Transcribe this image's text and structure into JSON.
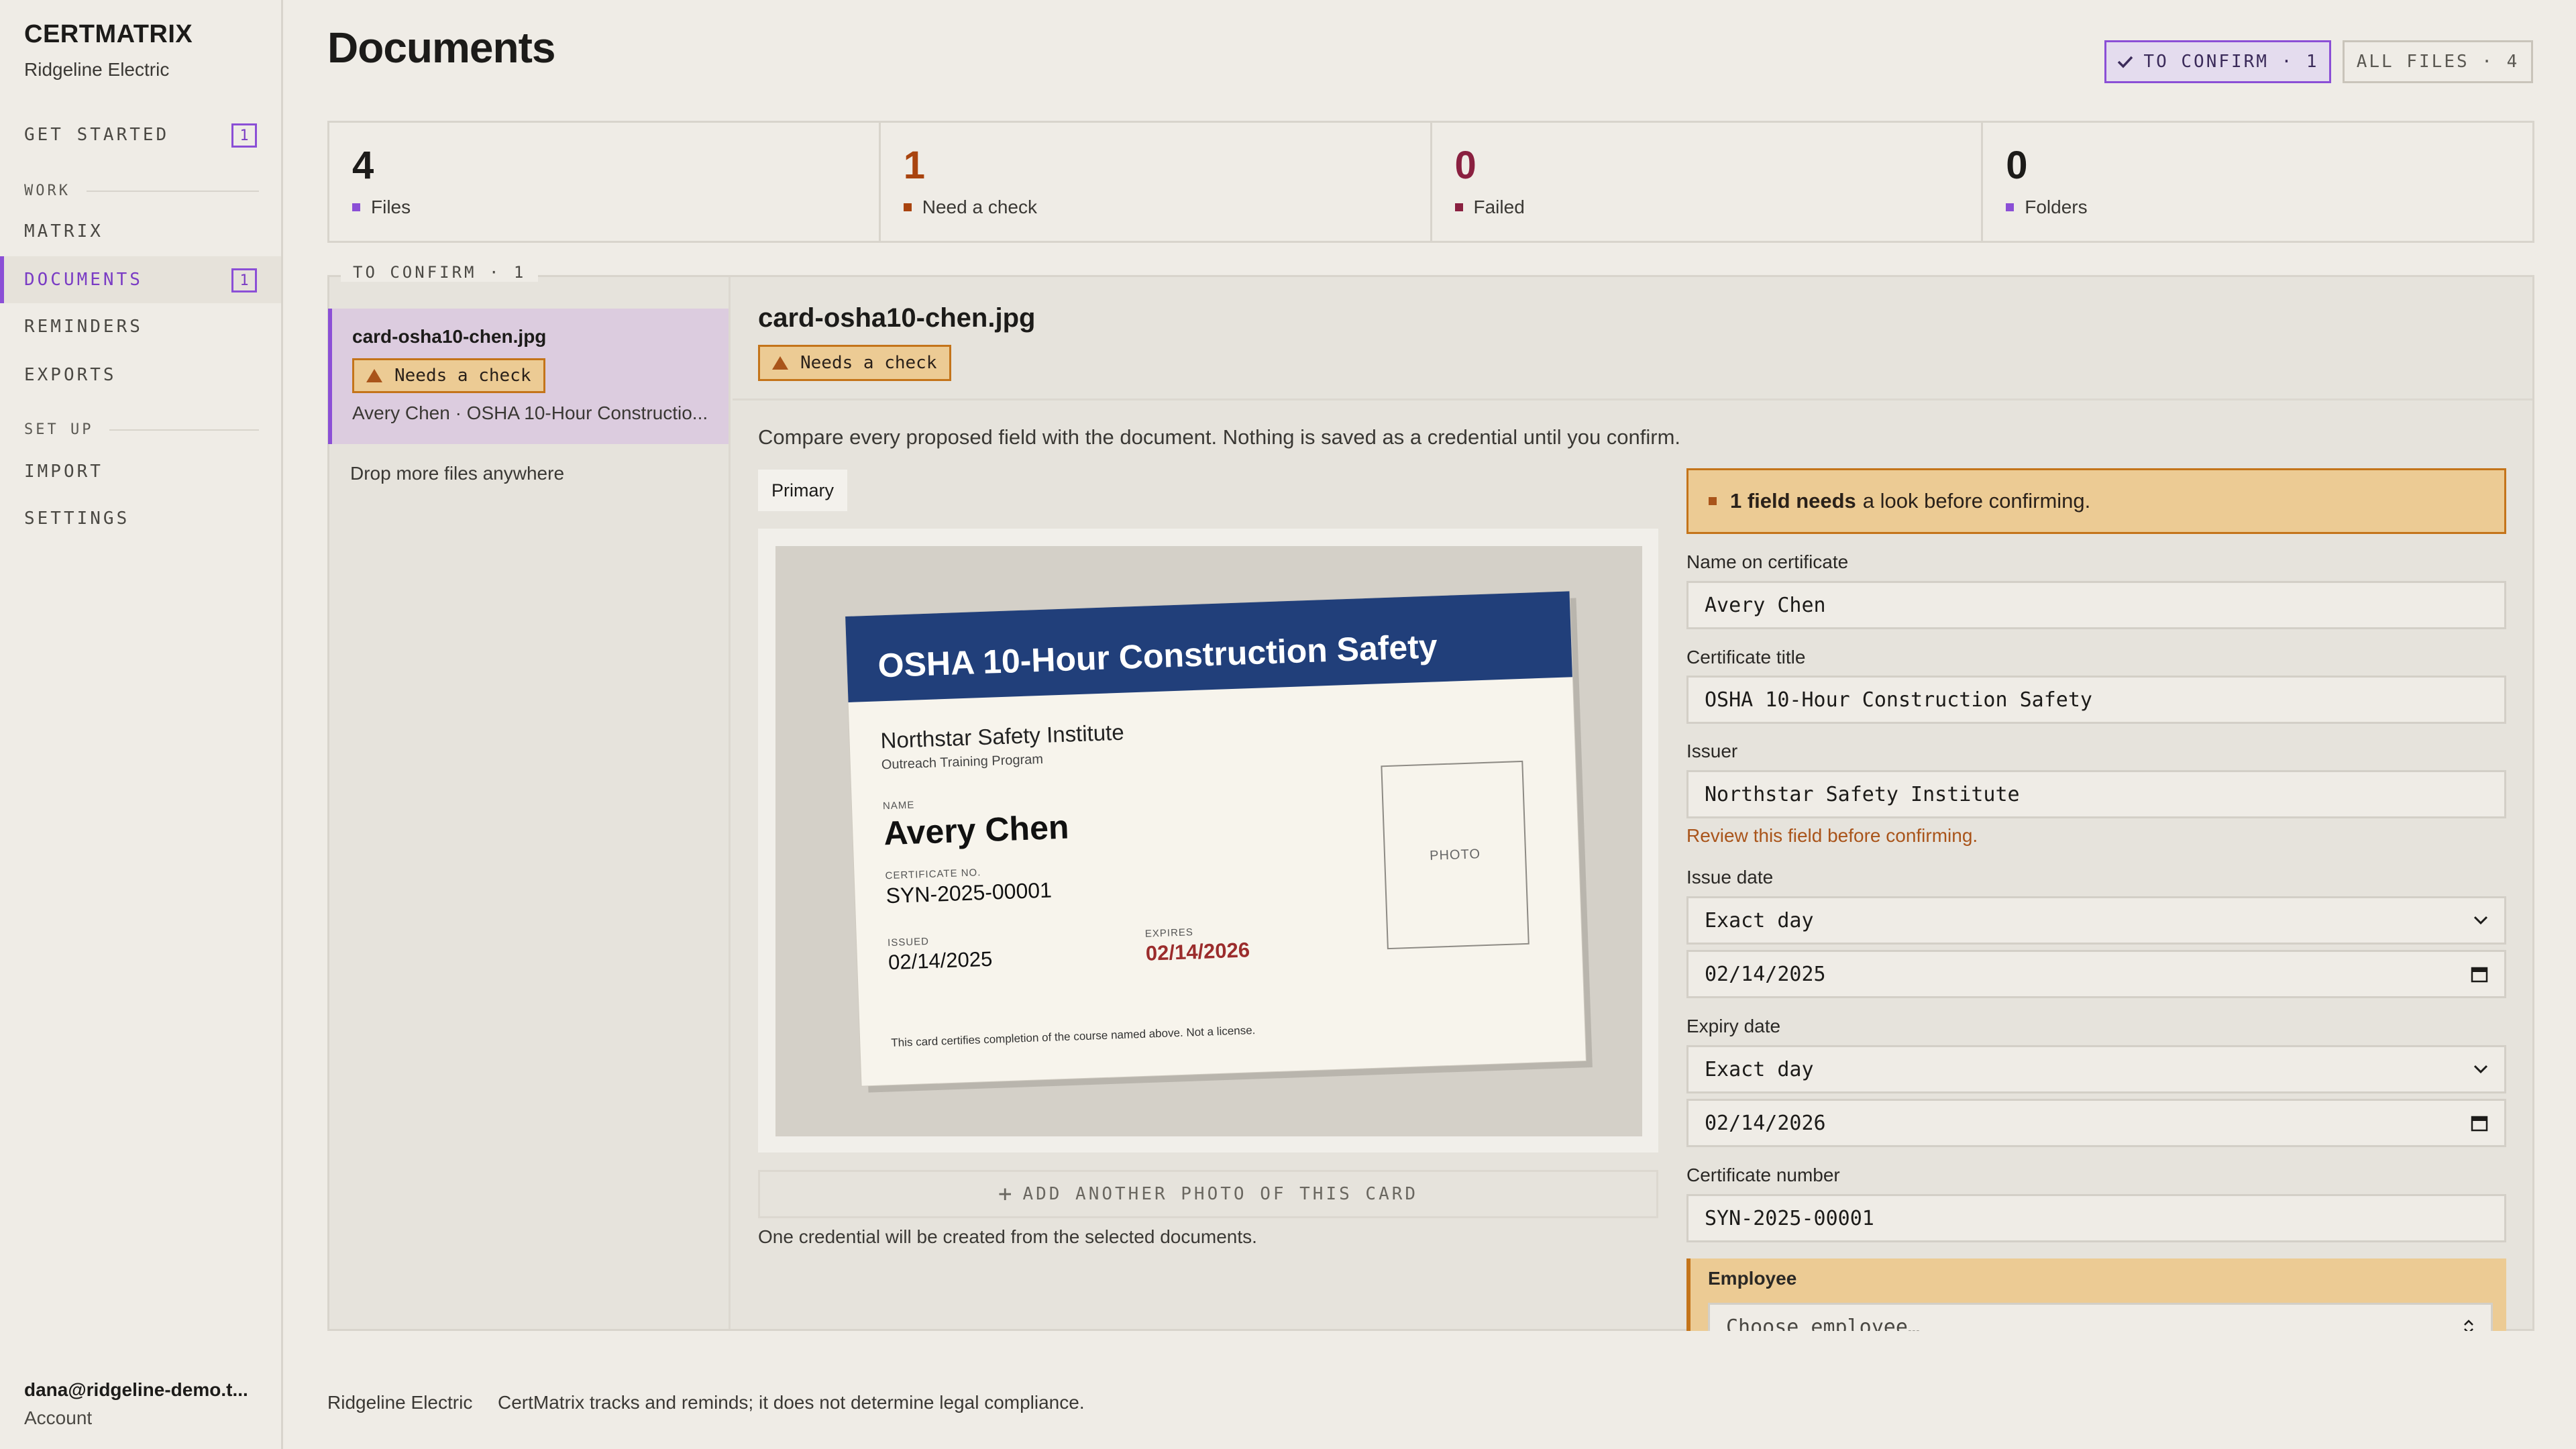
{
  "app": {
    "brand": "CERTMATRIX",
    "org": "Ridgeline Electric"
  },
  "sidebar": {
    "items": [
      {
        "label": "GET STARTED",
        "badge": "1"
      },
      {
        "section": "WORK"
      },
      {
        "label": "MATRIX"
      },
      {
        "label": "DOCUMENTS",
        "badge": "1",
        "active": true
      },
      {
        "label": "REMINDERS"
      },
      {
        "label": "EXPORTS"
      },
      {
        "section": "SET UP"
      },
      {
        "label": "IMPORT"
      },
      {
        "label": "SETTINGS"
      }
    ],
    "account_email": "dana@ridgeline-demo.t...",
    "account_label": "Account"
  },
  "header": {
    "title": "Documents",
    "to_confirm_label": "TO CONFIRM · 1",
    "all_files_label": "ALL FILES · 4"
  },
  "stats": [
    {
      "value": "4",
      "label": "Files",
      "color": "#1c1b19",
      "marker": "#8b4fd6"
    },
    {
      "value": "1",
      "label": "Need a check",
      "color": "#a9440f",
      "marker": "#a9440f"
    },
    {
      "value": "0",
      "label": "Failed",
      "color": "#8a2040",
      "marker": "#8a2040"
    },
    {
      "value": "0",
      "label": "Folders",
      "color": "#1c1b19",
      "marker": "#8b4fd6"
    }
  ],
  "queue": {
    "legend": "TO CONFIRM · 1",
    "items": [
      {
        "filename": "card-osha10-chen.jpg",
        "status": "Needs a check",
        "subtitle": "Avery Chen · OSHA 10-Hour Constructio..."
      }
    ],
    "drop_hint": "Drop more files anywhere"
  },
  "detail": {
    "filename": "card-osha10-chen.jpg",
    "status": "Needs a check",
    "note": "Compare every proposed field with the document. Nothing is saved as a credential until you confirm.",
    "primary_tab": "Primary",
    "card": {
      "title": "OSHA 10-Hour Construction Safety",
      "institute": "Northstar Safety Institute",
      "program": "Outreach Training Program",
      "name_label": "NAME",
      "name": "Avery Chen",
      "cert_label": "CERTIFICATE NO.",
      "cert_no": "SYN-2025-00001",
      "issued_label": "ISSUED",
      "issued": "02/14/2025",
      "expires_label": "EXPIRES",
      "expires": "02/14/2026",
      "photo_label": "PHOTO",
      "footer": "This card certifies completion of the course named above. Not a license."
    },
    "add_photo_label": "ADD ANOTHER PHOTO OF THIS CARD",
    "one_credential_note": "One credential will be created from the selected documents."
  },
  "form": {
    "warning_bold": "1 field needs",
    "warning_rest": "a look before confirming.",
    "name_label": "Name on certificate",
    "name_value": "Avery Chen",
    "title_label": "Certificate title",
    "title_value": "OSHA 10-Hour Construction Safety",
    "issuer_label": "Issuer",
    "issuer_value": "Northstar Safety Institute",
    "issuer_hint": "Review this field before confirming.",
    "issue_date_label": "Issue date",
    "issue_date_mode": "Exact day",
    "issue_date_value": "02/14/2025",
    "expiry_date_label": "Expiry date",
    "expiry_date_mode": "Exact day",
    "expiry_date_value": "02/14/2026",
    "cert_number_label": "Certificate number",
    "cert_number_value": "SYN-2025-00001",
    "employee_label": "Employee",
    "employee_placeholder": "Choose employee…"
  },
  "footer": {
    "org": "Ridgeline Electric",
    "note": "CertMatrix tracks and reminds; it does not determine legal compliance."
  }
}
